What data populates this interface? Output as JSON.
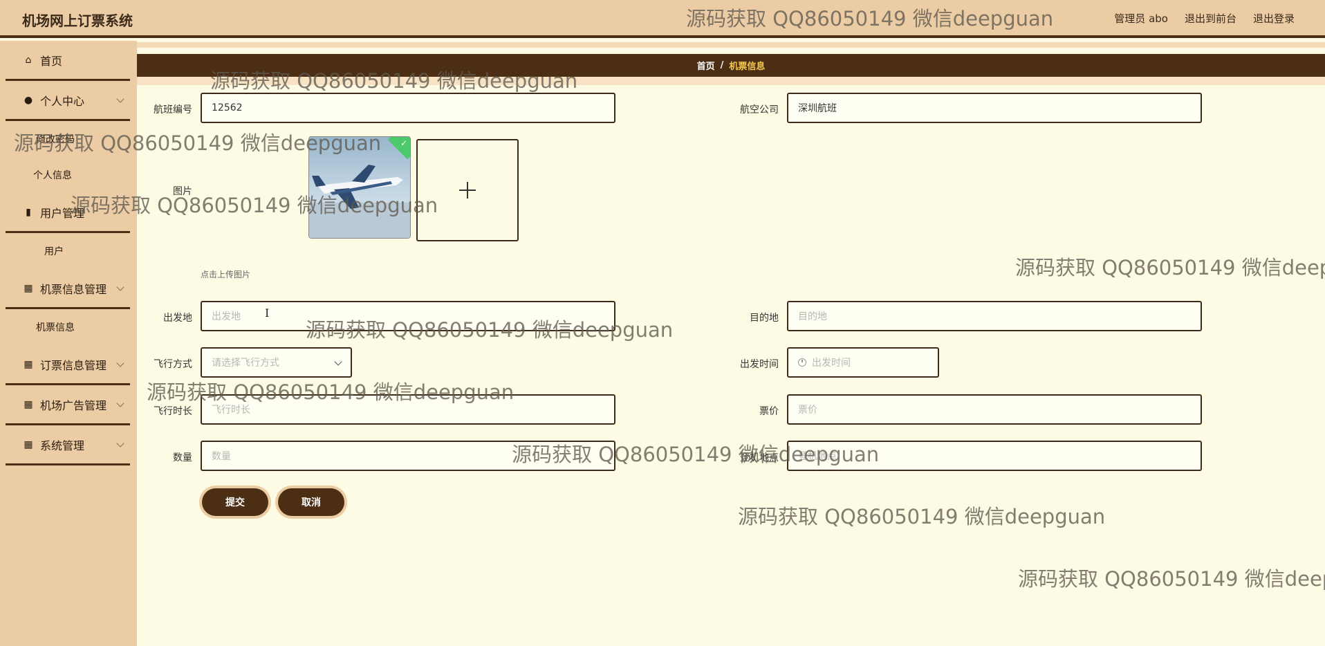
{
  "app": {
    "title": "机场网上订票系统"
  },
  "header": {
    "user_label": "管理员 abo",
    "front_label": "退出到前台",
    "logout_label": "退出登录"
  },
  "sidebar": {
    "home": "首页",
    "personal_center": "个人中心",
    "personal_center_sub": [
      "修改密码",
      "个人信息"
    ],
    "user_mgmt": "用户管理",
    "user_mgmt_sub": [
      "用户"
    ],
    "ticket_info_mgmt": "机票信息管理",
    "ticket_info_sub": [
      "机票信息"
    ],
    "order_mgmt": "订票信息管理",
    "ad_mgmt": "机场广告管理",
    "system_mgmt": "系统管理"
  },
  "breadcrumb": {
    "home": "首页",
    "sep": "/",
    "current": "机票信息"
  },
  "form": {
    "flight_no_label": "航班编号",
    "flight_no_value": "12562",
    "airline_label": "航空公司",
    "airline_value": "深圳航班",
    "image_label": "图片",
    "upload_hint": "点击上传图片",
    "origin_label": "出发地",
    "origin_placeholder": "出发地",
    "destination_label": "目的地",
    "destination_placeholder": "目的地",
    "mode_label": "飞行方式",
    "mode_placeholder": "请选择飞行方式",
    "depart_time_label": "出发时间",
    "depart_time_placeholder": "出发时间",
    "duration_label": "飞行时长",
    "duration_placeholder": "飞行时长",
    "price_label": "票价",
    "price_placeholder": "票价",
    "quantity_label": "数量",
    "quantity_placeholder": "数量",
    "boarding_label": "登机地点",
    "boarding_placeholder": "登机地点",
    "submit_label": "提交",
    "cancel_label": "取消"
  },
  "watermark": "源码获取 QQ86050149 微信deepguan",
  "colors": {
    "topbar": "#ebcca4",
    "accent_dark": "#4b2e14",
    "content_bg": "#fdfbe3",
    "breadcrumb_current": "#f5c84a"
  },
  "icons": [
    "home-icon",
    "user-icon",
    "bar-chart-icon",
    "grid-icon",
    "chevron-down-icon",
    "plus-icon",
    "clock-icon",
    "check-icon"
  ]
}
